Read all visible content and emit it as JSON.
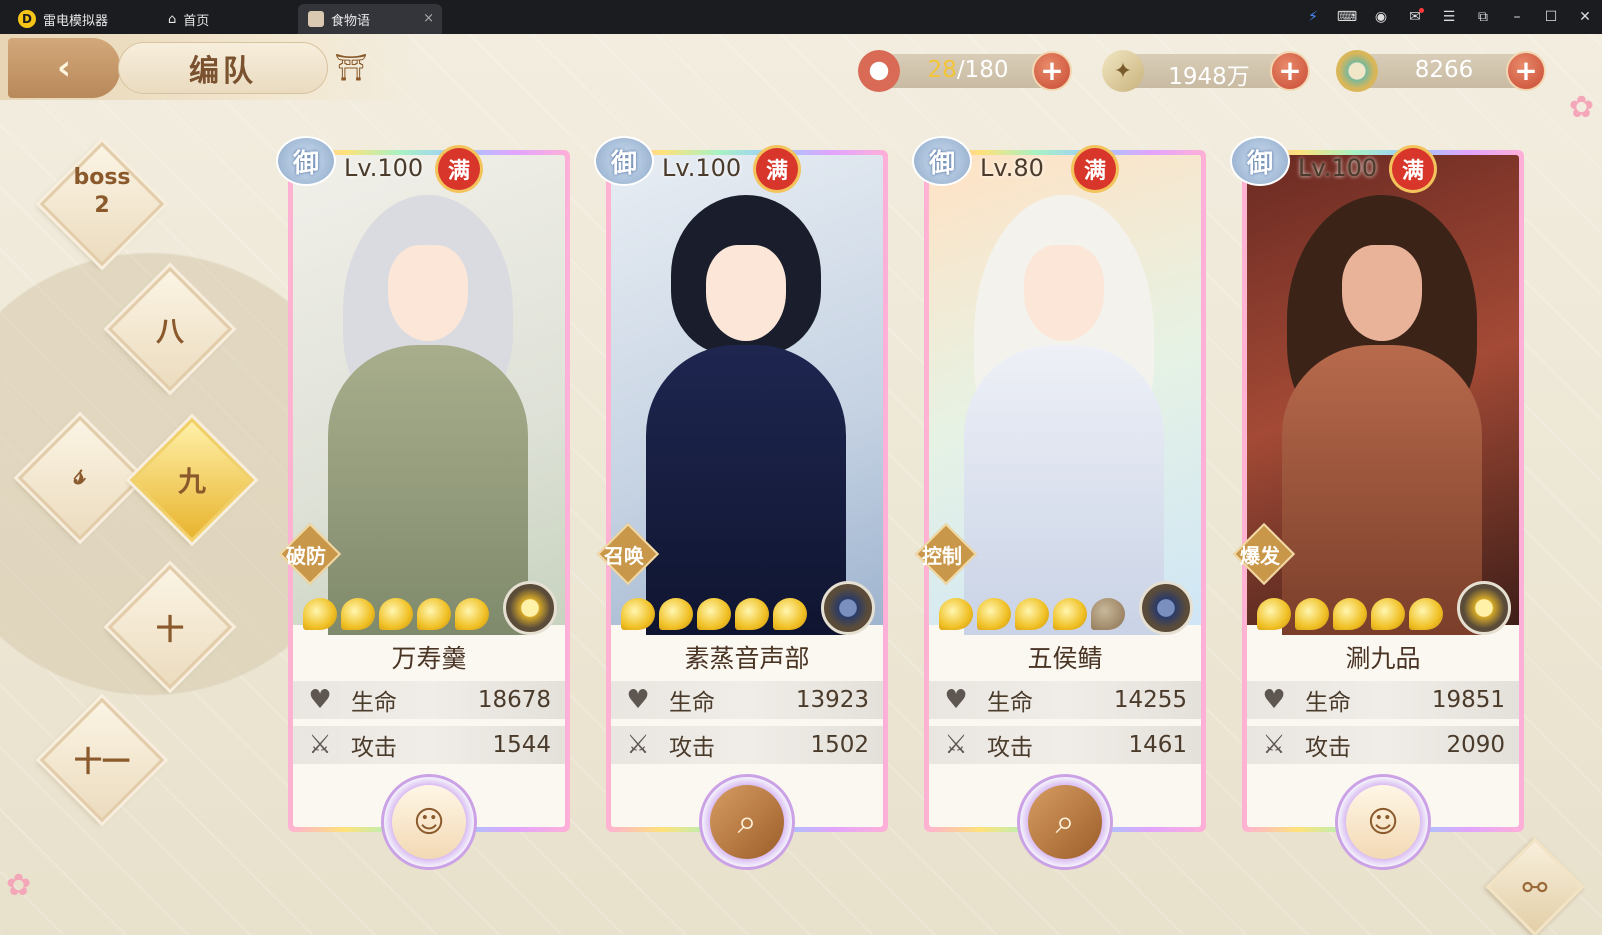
{
  "window": {
    "app_tab": "雷电模拟器",
    "home_tab": "首页",
    "game_tab": "食物语",
    "tab_close": "×",
    "app_logo": "D",
    "controls": [
      "⚡",
      "⌨",
      "◉",
      "✉",
      "☰",
      "⧉",
      "–",
      "☐",
      "✕"
    ]
  },
  "header": {
    "back_icon": "‹",
    "title": "编队",
    "pavilion_icon": "⛩"
  },
  "resources": {
    "stamina_current": "28",
    "stamina_max": "/180",
    "gold": "1948万",
    "jade": "8266",
    "plus": "+"
  },
  "stages": {
    "boss_line1": "boss",
    "boss_line2": "2",
    "eight": "八",
    "nine": "九",
    "rune": "𝓈",
    "ten": "十",
    "eleven": "十一"
  },
  "cards": [
    {
      "emblem": "御",
      "level": "Lv.100",
      "full": "满",
      "role": "破防",
      "name": "万寿羹",
      "hp_label": "生命",
      "hp": "18678",
      "atk_label": "攻击",
      "atk": "1544"
    },
    {
      "emblem": "御",
      "level": "Lv.100",
      "full": "满",
      "role": "召唤",
      "name": "素蒸音声部",
      "hp_label": "生命",
      "hp": "13923",
      "atk_label": "攻击",
      "atk": "1502"
    },
    {
      "emblem": "御",
      "level": "Lv.80",
      "full": "满",
      "role": "控制",
      "name": "五侯鲭",
      "hp_label": "生命",
      "hp": "14255",
      "atk_label": "攻击",
      "atk": "1461"
    },
    {
      "emblem": "御",
      "level": "Lv.100",
      "full": "满",
      "role": "爆发",
      "name": "涮九品",
      "hp_label": "生命",
      "hp": "19851",
      "atk_label": "攻击",
      "atk": "2090"
    }
  ],
  "icons": {
    "heart": "♥",
    "sword": "⚔",
    "magnifier": "⌕",
    "share": "⚯",
    "blossom": "✿"
  },
  "colors": {
    "accent_gold": "#f3c437",
    "plus_red": "#c84a34",
    "background": "#efeadb"
  }
}
